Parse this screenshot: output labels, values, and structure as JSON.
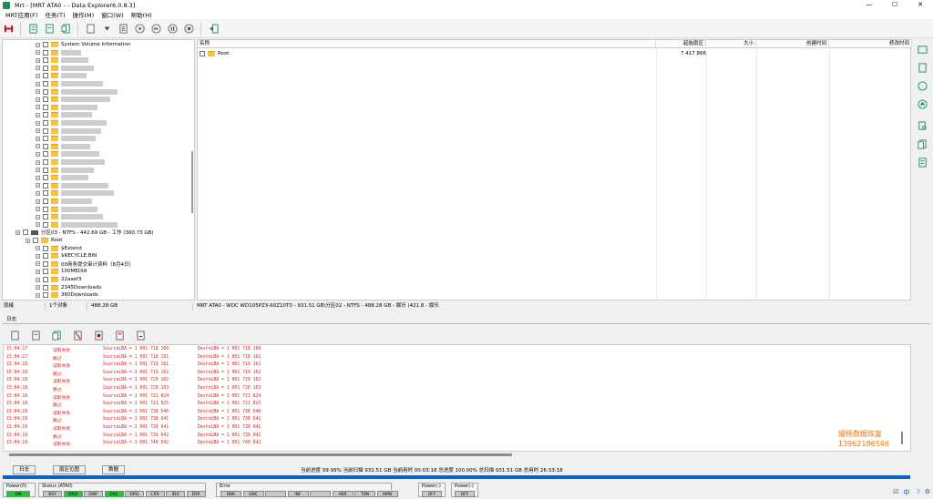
{
  "window": {
    "title": "Mrt - [MRT ATA0 - - Data Explorer6.0.8.3]"
  },
  "menu": [
    "MRT应用(F)",
    "任务(T)",
    "操作(M)",
    "窗口(W)",
    "帮助(H)"
  ],
  "tree": {
    "rows": [
      {
        "label": "System Volume Information",
        "level": 2,
        "blurred": false
      },
      {
        "label": "",
        "level": 2,
        "blurred": true
      },
      {
        "label": "",
        "level": 2,
        "blurred": true
      },
      {
        "label": "",
        "level": 2,
        "blurred": true
      },
      {
        "label": "",
        "level": 2,
        "blurred": true
      },
      {
        "label": "",
        "level": 2,
        "blurred": true
      },
      {
        "label": "",
        "level": 2,
        "blurred": true
      },
      {
        "label": "",
        "level": 2,
        "blurred": true
      },
      {
        "label": "",
        "level": 2,
        "blurred": true
      },
      {
        "label": "",
        "level": 2,
        "blurred": true
      },
      {
        "label": "",
        "level": 2,
        "blurred": true
      },
      {
        "label": "",
        "level": 2,
        "blurred": true
      },
      {
        "label": "",
        "level": 2,
        "blurred": true
      },
      {
        "label": "",
        "level": 2,
        "blurred": true
      },
      {
        "label": "",
        "level": 2,
        "blurred": true
      },
      {
        "label": "",
        "level": 2,
        "blurred": true
      },
      {
        "label": "",
        "level": 2,
        "blurred": true
      },
      {
        "label": "",
        "level": 2,
        "blurred": true
      },
      {
        "label": "",
        "level": 2,
        "blurred": true
      },
      {
        "label": "",
        "level": 2,
        "blurred": true
      },
      {
        "label": "",
        "level": 2,
        "blurred": true
      },
      {
        "label": "",
        "level": 2,
        "blurred": true
      },
      {
        "label": "",
        "level": 2,
        "blurred": true
      },
      {
        "label": "",
        "level": 2,
        "blurred": true
      },
      {
        "label": "分区03 - NTFS - 442.69 GB - 工作 (300.73 GB)",
        "level": 0,
        "blurred": false,
        "drive": true
      },
      {
        "label": "Root",
        "level": 1,
        "blurred": false
      },
      {
        "label": "$Extend",
        "level": 2,
        "blurred": false
      },
      {
        "label": "$RECYCLE.BIN",
        "level": 2,
        "blurred": false
      },
      {
        "label": "00商务提交审计资料（8月4日）",
        "level": 2,
        "blurred": false
      },
      {
        "label": "100MEDIA",
        "level": 2,
        "blurred": false
      },
      {
        "label": "22aaef3",
        "level": 2,
        "blurred": false
      },
      {
        "label": "2345Downloads",
        "level": 2,
        "blurred": false
      },
      {
        "label": "360Downloads",
        "level": 2,
        "blurred": false
      }
    ]
  },
  "list": {
    "columns": [
      "名称",
      "起始扇区",
      "大小",
      "创建时间",
      "修改时间"
    ],
    "rows": [
      {
        "name": "Root",
        "start": "7 417 866"
      }
    ]
  },
  "status": {
    "ready": "就绪",
    "count": "1个对象",
    "size": "488.28 GB",
    "path": "MRT ATA0 - WDC WD105PZX-60Z10T0 - 931.51 GB\\分区02 - NTFS - 488.28 GB - 娱乐 (421.8 - 娱乐"
  },
  "log": {
    "tab": "日志",
    "lines": [
      {
        "time": "15:04:17",
        "type": "读取失败",
        "src": "SourceLBA = 1 001 718 160",
        "dst": "DestnLBA =   1 001 718 160"
      },
      {
        "time": "15:04:17",
        "type": "跳过",
        "src": "SourceLBA = 1 001 718 161",
        "dst": "DestnLBA =   1 001 718 161"
      },
      {
        "time": "15:04:18",
        "type": "读取失败",
        "src": "SourceLBA = 1 001 719 161",
        "dst": "DestnLBA =   1 001 719 161"
      },
      {
        "time": "15:04:18",
        "type": "跳过",
        "src": "SourceLBA = 1 001 719 162",
        "dst": "DestnLBA =   1 001 719 162"
      },
      {
        "time": "15:04:18",
        "type": "读取失败",
        "src": "SourceLBA = 1 001 720 162",
        "dst": "DestnLBA =   1 001 720 162"
      },
      {
        "time": "15:04:18",
        "type": "跳过",
        "src": "SourceLBA = 1 001 720 163",
        "dst": "DestnLBA =   1 001 720 163"
      },
      {
        "time": "15:04:18",
        "type": "读取失败",
        "src": "SourceLBA = 1 001 721 824",
        "dst": "DestnLBA =   1 001 721 824"
      },
      {
        "time": "15:04:18",
        "type": "跳过",
        "src": "SourceLBA = 1 001 721 825",
        "dst": "DestnLBA =   1 001 721 825"
      },
      {
        "time": "15:04:18",
        "type": "读取失败",
        "src": "SourceLBA = 1 001 738 640",
        "dst": "DestnLBA =   1 001 738 640"
      },
      {
        "time": "15:04:18",
        "type": "跳过",
        "src": "SourceLBA = 1 001 738 641",
        "dst": "DestnLBA =   1 001 738 641"
      },
      {
        "time": "15:04:19",
        "type": "读取失败",
        "src": "SourceLBA = 1 001 739 641",
        "dst": "DestnLBA =   1 001 739 641"
      },
      {
        "time": "15:04:19",
        "type": "跳过",
        "src": "SourceLBA = 1 001 739 642",
        "dst": "DestnLBA =   1 001 739 642"
      },
      {
        "time": "15:04:19",
        "type": "读取失败",
        "src": "SourceLBA = 1 001 740 642",
        "dst": "DestnLBA =   1 001 740 642"
      }
    ]
  },
  "watermark": {
    "line1": "嫚扬数据恢复",
    "line2": "13962186546"
  },
  "bottom_tabs": [
    "日志",
    "扇区位图",
    "数据"
  ],
  "progress": {
    "text": "当前进度 99.99% 当前扫描 931.51 GB 当前用时 00:03:18   总进度 100.00% 总扫描 931.51 GB 总用时 26:33:18",
    "fraction": 0.9999
  },
  "panels": {
    "power0": {
      "label": "Power(0)",
      "leds": [
        {
          "t": "ON",
          "on": true
        }
      ]
    },
    "status": {
      "label": "Status (ATA0)",
      "leds": [
        {
          "t": "BSY",
          "on": false
        },
        {
          "t": "DRD",
          "on": true
        },
        {
          "t": "DWF",
          "on": false
        },
        {
          "t": "DSC",
          "on": true
        },
        {
          "t": "DRQ",
          "on": false
        },
        {
          "t": "CRR",
          "on": false
        },
        {
          "t": "IDX",
          "on": false
        },
        {
          "t": "ERR",
          "on": false
        }
      ]
    },
    "error": {
      "label": "Error",
      "leds": [
        {
          "t": "BBK",
          "on": false
        },
        {
          "t": "UNC",
          "on": false
        },
        {
          "t": "",
          "on": false
        },
        {
          "t": "INF",
          "on": false
        },
        {
          "t": "",
          "on": false
        },
        {
          "t": "ABR",
          "on": false
        },
        {
          "t": "T0N",
          "on": false
        },
        {
          "t": "AMN",
          "on": false
        }
      ]
    },
    "power1": {
      "label": "Power(-)",
      "leds": [
        {
          "t": "OFF",
          "on": false
        }
      ]
    },
    "power2": {
      "label": "Power(-)",
      "leds": [
        {
          "t": "OFF",
          "on": false
        }
      ]
    }
  },
  "tray": [
    "中",
    "☽",
    "⚙"
  ]
}
